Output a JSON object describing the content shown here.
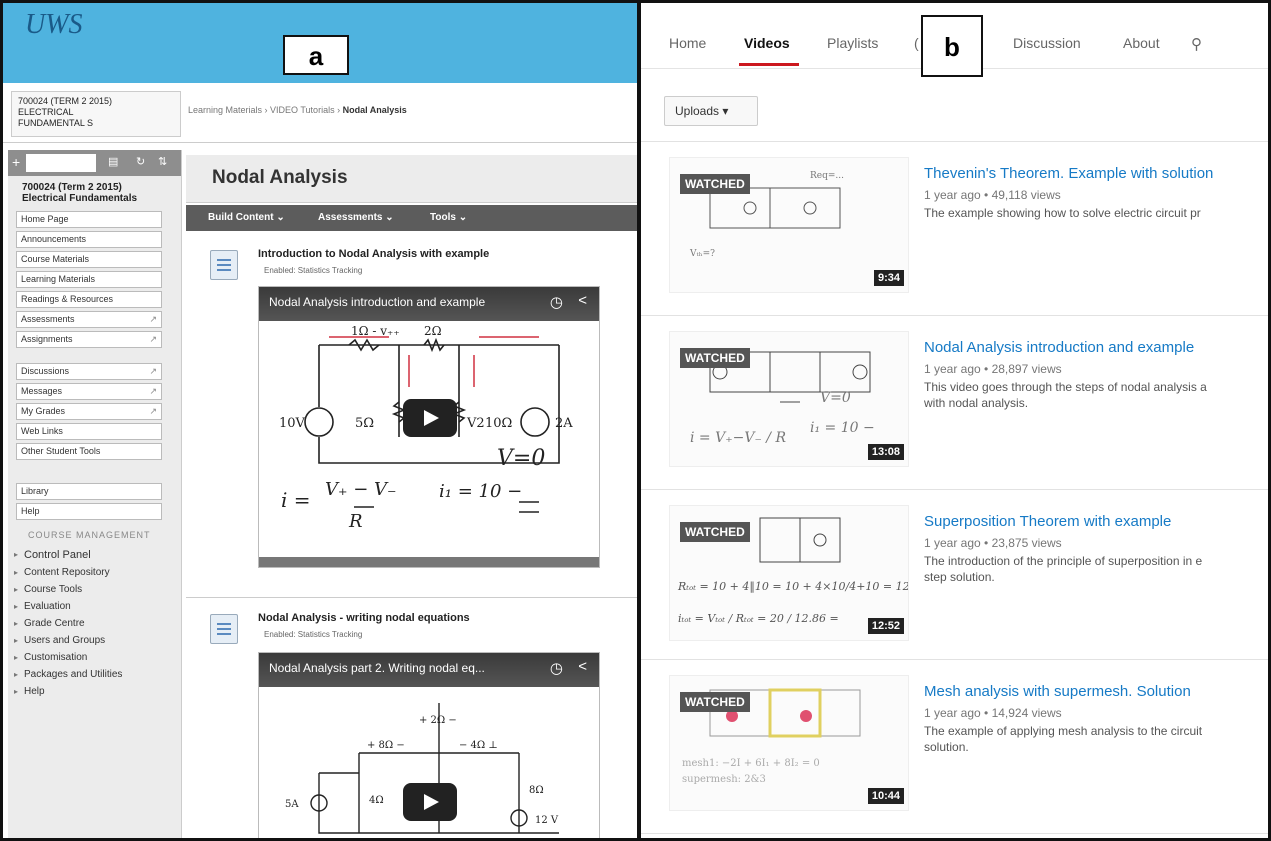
{
  "labels": {
    "a": "a",
    "b": "b"
  },
  "lms": {
    "logo": "UWS",
    "course_box": [
      "700024 (TERM 2 2015)",
      "ELECTRICAL",
      "FUNDAMENTAL S"
    ],
    "breadcrumb": {
      "part1": "Learning Materials",
      "part2": "VIDEO Tutorials",
      "current": "Nodal Analysis"
    },
    "sidebar": {
      "course_title": [
        "700024 (Term 2 2015)",
        "Electrical Fundamentals"
      ],
      "group1": [
        "Home Page",
        "Announcements",
        "Course Materials",
        "Learning Materials",
        "Readings & Resources",
        "Assessments",
        "Assignments"
      ],
      "group2": [
        "Discussions",
        "Messages",
        "My Grades",
        "Web Links",
        "Other Student Tools"
      ],
      "group3": [
        "Library",
        "Help"
      ],
      "management_title": "COURSE MANAGEMENT",
      "management": [
        "Control Panel",
        "Content Repository",
        "Course Tools",
        "Evaluation",
        "Grade Centre",
        "Users and Groups",
        "Customisation",
        "Packages and Utilities",
        "Help"
      ]
    },
    "page_title": "Nodal Analysis",
    "actions": {
      "build": "Build Content ⌄",
      "assess": "Assessments ⌄",
      "tools": "Tools ⌄"
    },
    "items": [
      {
        "title": "Introduction to Nodal Analysis with example",
        "enabled": "Enabled:  Statistics Tracking",
        "video_title": "Nodal Analysis introduction and example"
      },
      {
        "title": "Nodal Analysis - writing nodal equations",
        "enabled": "Enabled:  Statistics Tracking",
        "video_title": "Nodal Analysis part 2. Writing nodal eq..."
      }
    ]
  },
  "youtube": {
    "nav": {
      "home": "Home",
      "videos": "Videos",
      "playlists": "Playlists",
      "discussion": "Discussion",
      "about": "About"
    },
    "uploads": "Uploads ▾",
    "watched_label": "WATCHED",
    "videos": [
      {
        "title": "Thevenin's Theorem. Example with solution",
        "meta": "1 year ago  •  49,118 views",
        "desc": "The example showing how to solve electric circuit pr",
        "duration": "9:34"
      },
      {
        "title": "Nodal Analysis introduction and example",
        "meta": "1 year ago  •  28,897 views",
        "desc": "This video goes through the steps of nodal analysis a\nwith nodal analysis.",
        "duration": "13:08"
      },
      {
        "title": "Superposition Theorem with example",
        "meta": "1 year ago  •  23,875 views",
        "desc": "The introduction of the principle of superposition in e\nstep solution.",
        "duration": "12:52"
      },
      {
        "title": "Mesh analysis with supermesh. Solution",
        "meta": "1 year ago  •  14,924 views",
        "desc": "The example of applying mesh analysis to the circuit\nsolution.",
        "duration": "10:44"
      }
    ]
  },
  "colors": {
    "lms_top": "#4fb3df",
    "yt_link": "#167ac6",
    "yt_red": "#cc181e"
  }
}
